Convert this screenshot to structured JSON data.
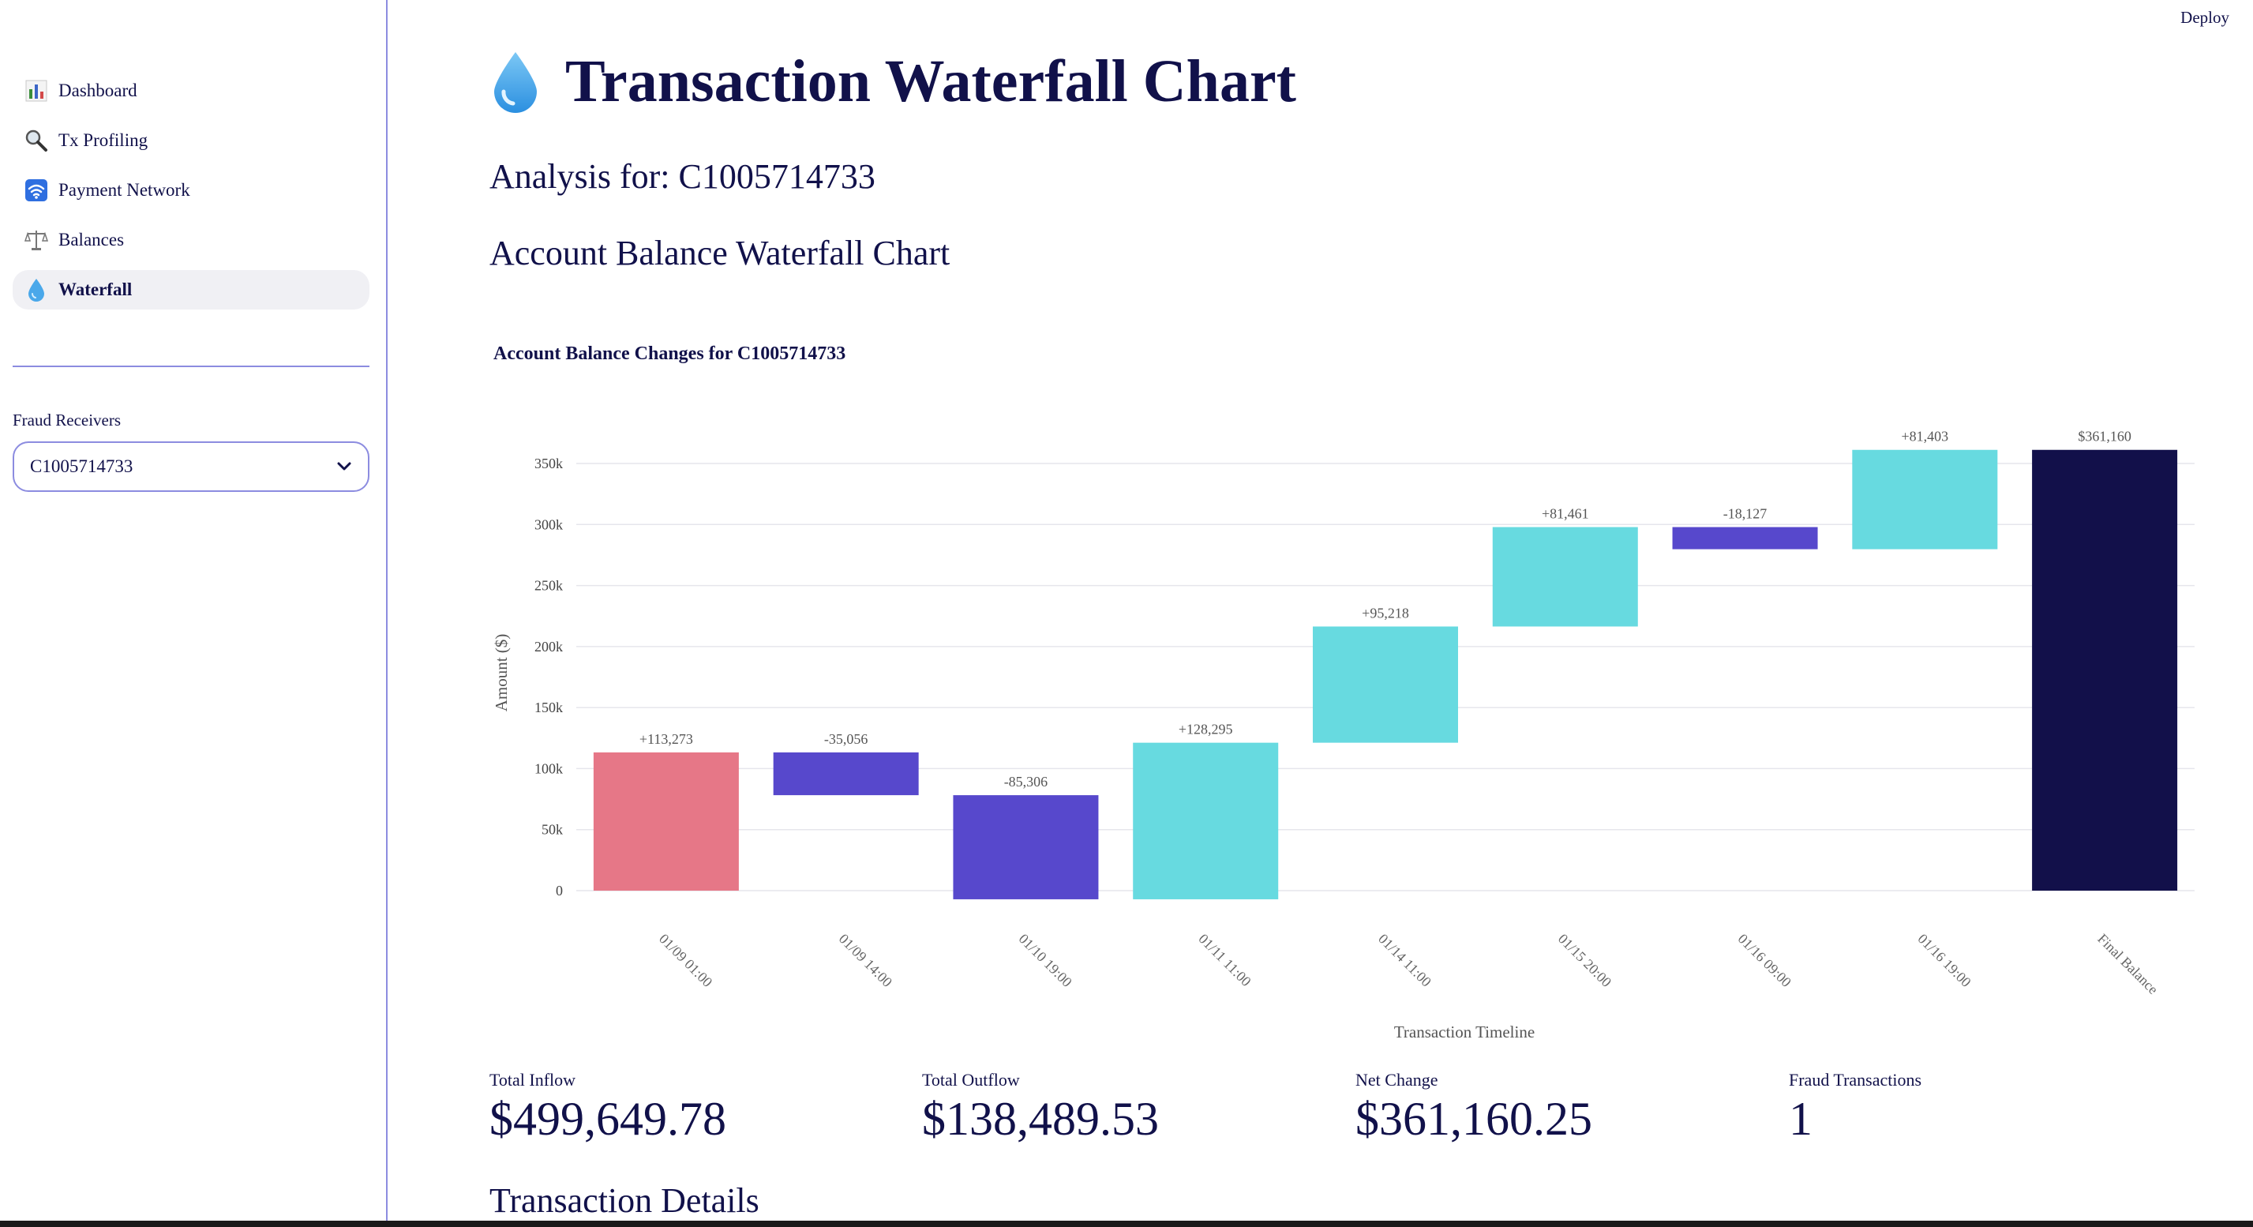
{
  "header": {
    "deploy_label": "Deploy"
  },
  "sidebar": {
    "items": [
      {
        "label": "Dashboard",
        "icon": "bar-chart-icon",
        "active": false
      },
      {
        "label": "Tx Profiling",
        "icon": "magnifier-icon",
        "active": false
      },
      {
        "label": "Payment Network",
        "icon": "wifi-icon",
        "active": false
      },
      {
        "label": "Balances",
        "icon": "scales-icon",
        "active": false
      },
      {
        "label": "Waterfall",
        "icon": "droplet-icon",
        "active": true
      }
    ],
    "select_label": "Fraud Receivers",
    "select_value": "C1005714733"
  },
  "main": {
    "title": "Transaction Waterfall Chart",
    "title_icon": "droplet-icon",
    "analysis": "Analysis for: C1005714733",
    "section_heading": "Account Balance Waterfall Chart",
    "details_heading": "Transaction Details"
  },
  "metrics": [
    {
      "label": "Total Inflow",
      "value": "$499,649.78"
    },
    {
      "label": "Total Outflow",
      "value": "$138,489.53"
    },
    {
      "label": "Net Change",
      "value": "$361,160.25"
    },
    {
      "label": "Fraud Transactions",
      "value": "1"
    }
  ],
  "colors": {
    "fraud": "#e67787",
    "decrease": "#5748cc",
    "increase": "#67dae0",
    "total": "#12104a",
    "text_dark": "#11114a"
  },
  "chart_data": {
    "type": "waterfall",
    "title": "Account Balance Changes for C1005714733",
    "xlabel": "Transaction Timeline",
    "ylabel": "Amount ($)",
    "ylim": [
      -10000,
      370000
    ],
    "yticks": [
      0,
      50000,
      100000,
      150000,
      200000,
      250000,
      300000,
      350000
    ],
    "ytick_labels": [
      "0",
      "50k",
      "100k",
      "150k",
      "200k",
      "250k",
      "300k",
      "350k"
    ],
    "grid": true,
    "legend": "none",
    "categories": [
      "01/09 01:00",
      "01/09 14:00",
      "01/10 19:00",
      "01/11 11:00",
      "01/14 11:00",
      "01/15 20:00",
      "01/16 09:00",
      "01/16 19:00",
      "Final Balance"
    ],
    "bars": [
      {
        "label": "+113,273",
        "base": 0,
        "end": 113273,
        "kind": "fraud"
      },
      {
        "label": "-35,056",
        "base": 113273,
        "end": 78217,
        "kind": "decrease"
      },
      {
        "label": "-85,306",
        "base": 78217,
        "end": -7089,
        "kind": "decrease"
      },
      {
        "label": "+128,295",
        "base": -7089,
        "end": 121206,
        "kind": "increase"
      },
      {
        "label": "+95,218",
        "base": 121206,
        "end": 216424,
        "kind": "increase"
      },
      {
        "label": "+81,461",
        "base": 216424,
        "end": 297885,
        "kind": "increase"
      },
      {
        "label": "-18,127",
        "base": 297885,
        "end": 279758,
        "kind": "decrease"
      },
      {
        "label": "+81,403",
        "base": 279758,
        "end": 361160,
        "kind": "increase"
      },
      {
        "label": "$361,160",
        "base": 0,
        "end": 361160,
        "kind": "total"
      }
    ]
  }
}
